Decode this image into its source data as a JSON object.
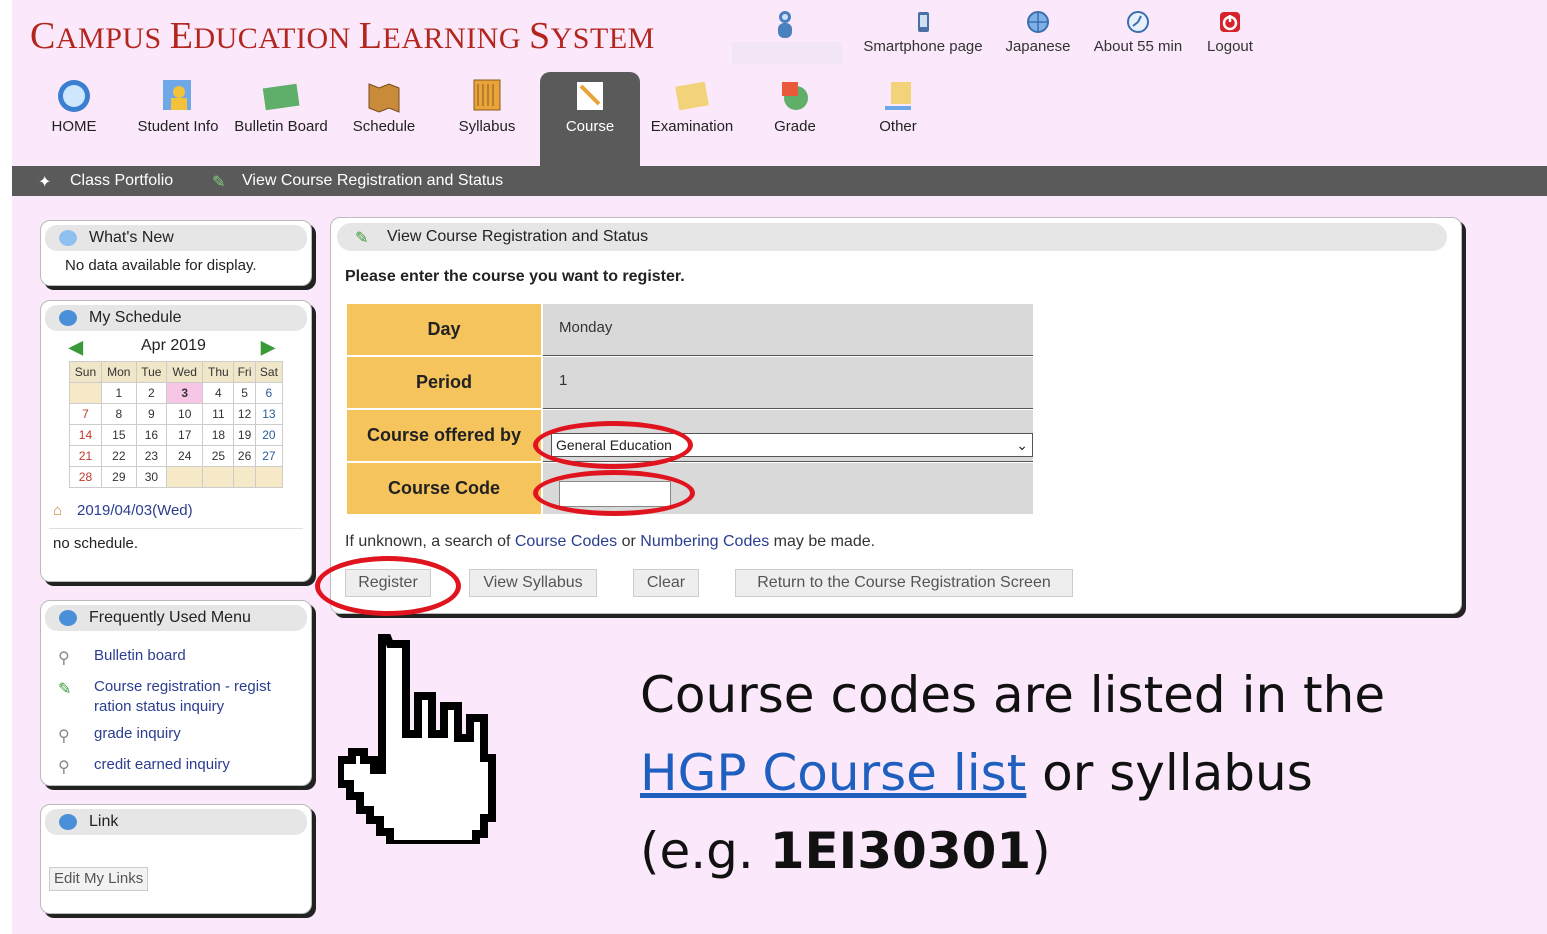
{
  "header": {
    "title_parts": [
      {
        "big": "C",
        "rest": "AMPUS "
      },
      {
        "big": "E",
        "rest": "DUCATION "
      },
      {
        "big": "L",
        "rest": "EARNING "
      },
      {
        "big": "S",
        "rest": "YSTEM"
      }
    ],
    "links": [
      {
        "label": "Smartphone page",
        "icon": "smartphone-icon"
      },
      {
        "label": "Japanese",
        "icon": "globe-icon"
      },
      {
        "label": "About 55 min",
        "icon": "clock-icon"
      },
      {
        "label": "Logout",
        "icon": "power-icon"
      }
    ]
  },
  "nav": {
    "items": [
      {
        "label": "HOME",
        "icon": "home-icon"
      },
      {
        "label": "Student Info",
        "icon": "student-icon"
      },
      {
        "label": "Bulletin Board",
        "icon": "bulletin-icon"
      },
      {
        "label": "Schedule",
        "icon": "schedule-icon"
      },
      {
        "label": "Syllabus",
        "icon": "syllabus-icon"
      },
      {
        "label": "Course",
        "icon": "course-icon",
        "active": true
      },
      {
        "label": "Examination",
        "icon": "exam-icon"
      },
      {
        "label": "Grade",
        "icon": "grade-icon"
      },
      {
        "label": "Other",
        "icon": "other-icon"
      }
    ]
  },
  "breadcrumb": {
    "items": [
      "Class Portfolio",
      "View Course Registration and Status"
    ]
  },
  "sidebar": {
    "whats_new": {
      "title": "What's New",
      "text": "No data available for display."
    },
    "schedule": {
      "title": "My Schedule",
      "month": "Apr 2019",
      "days": [
        "Sun",
        "Mon",
        "Tue",
        "Wed",
        "Thu",
        "Fri",
        "Sat"
      ],
      "weeks": [
        [
          "",
          "1",
          "2",
          "3",
          "4",
          "5",
          "6"
        ],
        [
          "7",
          "8",
          "9",
          "10",
          "11",
          "12",
          "13"
        ],
        [
          "14",
          "15",
          "16",
          "17",
          "18",
          "19",
          "20"
        ],
        [
          "21",
          "22",
          "23",
          "24",
          "25",
          "26",
          "27"
        ],
        [
          "28",
          "29",
          "30",
          "",
          "",
          "",
          ""
        ]
      ],
      "today": "3",
      "selected_date": "2019/04/03(Wed)",
      "text": "no schedule."
    },
    "frequent": {
      "title": "Frequently Used Menu",
      "items": [
        {
          "label": "Bulletin board",
          "icon": "magnifier-icon"
        },
        {
          "label": "Course registration - regist ration status inquiry",
          "icon": "pencil-icon"
        },
        {
          "label": "grade inquiry",
          "icon": "magnifier-icon"
        },
        {
          "label": "credit earned inquiry",
          "icon": "magnifier-icon"
        }
      ]
    },
    "link": {
      "title": "Link",
      "button": "Edit My Links"
    }
  },
  "main": {
    "title": "View Course Registration and Status",
    "instruction": "Please enter the course you want to register.",
    "fields": [
      {
        "label": "Day",
        "value": "Monday"
      },
      {
        "label": "Period",
        "value": "1"
      },
      {
        "label": "Course offered by",
        "value": "General Education"
      },
      {
        "label": "Course Code",
        "value": ""
      }
    ],
    "hint": {
      "prefix": "If unknown, a search of ",
      "link1": "Course Codes",
      "mid": " or ",
      "link2": "Numbering Codes",
      "suffix": " may be made."
    },
    "buttons": [
      "Register",
      "View Syllabus",
      "Clear",
      "Return to the Course Registration Screen"
    ]
  },
  "caption": {
    "line1": "Course codes are listed in the",
    "link": "HGP Course list",
    "line2_rest": " or syllabus",
    "line3_prefix": "(e.g. ",
    "example": "1EI30301",
    "line3_suffix": ")"
  },
  "colors": {
    "title": "#b3261e",
    "highlight": "#e0141e",
    "label_bg": "#f6c45c",
    "bar": "#5a5a5a",
    "background": "#fbe9fb"
  }
}
